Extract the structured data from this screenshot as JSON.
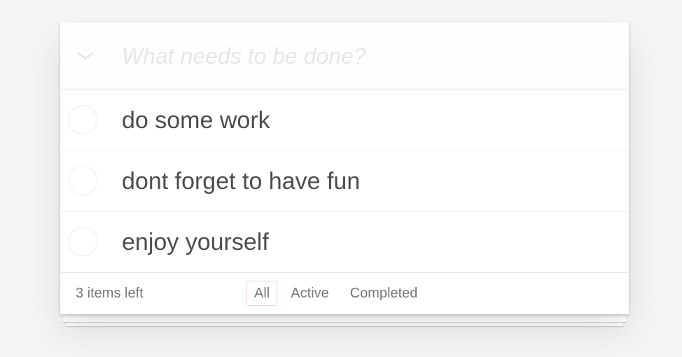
{
  "header": {
    "toggle_all_icon": "chevron-down-icon",
    "new_todo_placeholder": "What needs to be done?",
    "new_todo_value": ""
  },
  "todos": [
    {
      "label": "do some work",
      "completed": false
    },
    {
      "label": "dont forget to have fun",
      "completed": false
    },
    {
      "label": "enjoy yourself",
      "completed": false
    }
  ],
  "footer": {
    "count_text": "3 items left",
    "filters": [
      {
        "label": "All",
        "selected": true
      },
      {
        "label": "Active",
        "selected": false
      },
      {
        "label": "Completed",
        "selected": false
      }
    ]
  },
  "colors": {
    "page_background": "#f5f5f5",
    "text": "#4d4d4d",
    "placeholder": "#e6e6e6",
    "selected_filter_border": "#efd5d5"
  }
}
